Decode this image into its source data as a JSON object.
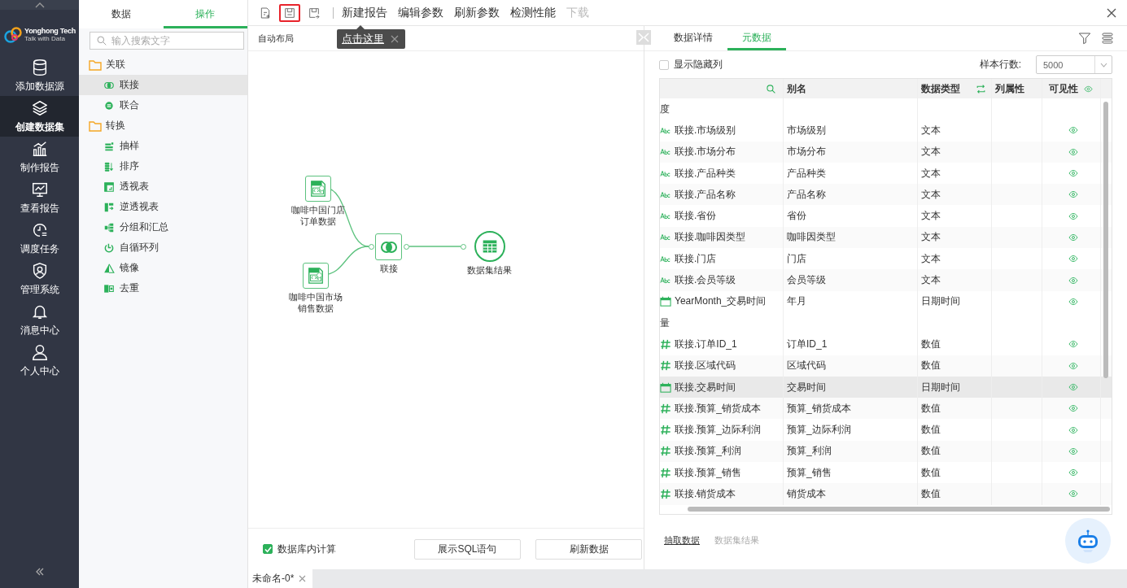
{
  "sidebar": {
    "logo": {
      "name": "Yonghong Tech",
      "tagline": "Talk with Data"
    },
    "items": [
      {
        "label": "添加数据源",
        "selected": false
      },
      {
        "label": "创建数据集",
        "selected": true
      },
      {
        "label": "制作报告",
        "selected": false
      },
      {
        "label": "查看报告",
        "selected": false
      },
      {
        "label": "调度任务",
        "selected": false
      },
      {
        "label": "管理系统",
        "selected": false
      },
      {
        "label": "消息中心",
        "selected": false
      },
      {
        "label": "个人中心",
        "selected": false
      }
    ]
  },
  "left_panel": {
    "tabs": [
      {
        "label": "数据",
        "selected": false
      },
      {
        "label": "操作",
        "selected": true
      }
    ],
    "search": {
      "placeholder": "输入搜索文字"
    },
    "tree": [
      {
        "label": "关联",
        "children": [
          {
            "label": "联接",
            "selected": true
          },
          {
            "label": "联合",
            "selected": false
          }
        ]
      },
      {
        "label": "转换",
        "children": [
          {
            "label": "抽样",
            "selected": false
          },
          {
            "label": "排序",
            "selected": false
          },
          {
            "label": "透视表",
            "selected": false
          },
          {
            "label": "逆透视表",
            "selected": false
          },
          {
            "label": "分组和汇总",
            "selected": false
          },
          {
            "label": "自循环列",
            "selected": false
          },
          {
            "label": "镜像",
            "selected": false
          },
          {
            "label": "去重",
            "selected": false
          }
        ]
      }
    ]
  },
  "toolbar": {
    "icon_buttons": [
      {
        "highlighted": false
      },
      {
        "highlighted": true
      },
      {
        "highlighted": false
      }
    ],
    "actions": [
      {
        "label": "新建报告",
        "disabled": false
      },
      {
        "label": "编辑参数",
        "disabled": false
      },
      {
        "label": "刷新参数",
        "disabled": false
      },
      {
        "label": "检测性能",
        "disabled": false
      },
      {
        "label": "下载",
        "disabled": true
      }
    ],
    "tooltip": {
      "text": "点击这里"
    }
  },
  "canvas": {
    "layout_label": "自动布局",
    "nodes": [
      {
        "kind": "sql",
        "lines": [
          "咖啡中国门店",
          "订单数据"
        ]
      },
      {
        "kind": "sql",
        "lines": [
          "咖啡中国市场",
          "销售数据"
        ]
      },
      {
        "kind": "join",
        "lines": [
          "联接"
        ]
      },
      {
        "kind": "result",
        "lines": [
          "数据集结果"
        ]
      }
    ],
    "in_database": {
      "label": "数据库内计算",
      "checked": true
    },
    "buttons": [
      "展示SQL语句",
      "刷新数据"
    ]
  },
  "meta": {
    "tabs": [
      {
        "label": "数据详情",
        "selected": false
      },
      {
        "label": "元数据",
        "selected": true
      }
    ],
    "show_hidden": {
      "label": "显示隐藏列",
      "checked": false
    },
    "sample_rows": {
      "label": "样本行数:",
      "value": "5000"
    },
    "columns": [
      "别名",
      "数据类型",
      "列属性",
      "可见性"
    ],
    "rows": [
      {
        "kind": "group",
        "label": "度"
      },
      {
        "kind": "text",
        "name": "联接.市场级别",
        "alias": "市场级别",
        "data_type": "文本",
        "visible": true,
        "selected": false
      },
      {
        "kind": "text",
        "name": "联接.市场分布",
        "alias": "市场分布",
        "data_type": "文本",
        "visible": true,
        "selected": false
      },
      {
        "kind": "text",
        "name": "联接.产品种类",
        "alias": "产品种类",
        "data_type": "文本",
        "visible": true,
        "selected": false
      },
      {
        "kind": "text",
        "name": "联接.产品名称",
        "alias": "产品名称",
        "data_type": "文本",
        "visible": true,
        "selected": false
      },
      {
        "kind": "text",
        "name": "联接.省份",
        "alias": "省份",
        "data_type": "文本",
        "visible": true,
        "selected": false
      },
      {
        "kind": "text",
        "name": "联接.咖啡因类型",
        "alias": "咖啡因类型",
        "data_type": "文本",
        "visible": true,
        "selected": false
      },
      {
        "kind": "text",
        "name": "联接.门店",
        "alias": "门店",
        "data_type": "文本",
        "visible": true,
        "selected": false
      },
      {
        "kind": "text",
        "name": "联接.会员等级",
        "alias": "会员等级",
        "data_type": "文本",
        "visible": true,
        "selected": false
      },
      {
        "kind": "date",
        "name": "YearMonth_交易时间",
        "alias": "年月",
        "data_type": "日期时间",
        "visible": true,
        "selected": false
      },
      {
        "kind": "group",
        "label": "量"
      },
      {
        "kind": "number",
        "name": "联接.订单ID_1",
        "alias": "订单ID_1",
        "data_type": "数值",
        "visible": true,
        "selected": false
      },
      {
        "kind": "number",
        "name": "联接.区域代码",
        "alias": "区域代码",
        "data_type": "数值",
        "visible": true,
        "selected": false
      },
      {
        "kind": "date",
        "name": "联接.交易时间",
        "alias": "交易时间",
        "data_type": "日期时间",
        "visible": true,
        "selected": true
      },
      {
        "kind": "number",
        "name": "联接.预算_销货成本",
        "alias": "预算_销货成本",
        "data_type": "数值",
        "visible": true,
        "selected": false
      },
      {
        "kind": "number",
        "name": "联接.预算_边际利润",
        "alias": "预算_边际利润",
        "data_type": "数值",
        "visible": true,
        "selected": false
      },
      {
        "kind": "number",
        "name": "联接.预算_利润",
        "alias": "预算_利润",
        "data_type": "数值",
        "visible": true,
        "selected": false
      },
      {
        "kind": "number",
        "name": "联接.预算_销售",
        "alias": "预算_销售",
        "data_type": "数值",
        "visible": true,
        "selected": false
      },
      {
        "kind": "number",
        "name": "联接.销货成本",
        "alias": "销货成本",
        "data_type": "数值",
        "visible": true,
        "selected": false
      }
    ],
    "links": [
      {
        "label": "抽取数据",
        "disabled": false
      },
      {
        "label": "数据集结果",
        "disabled": true
      }
    ]
  },
  "tabbar": {
    "tabs": [
      {
        "label": "未命名-0*"
      }
    ]
  }
}
